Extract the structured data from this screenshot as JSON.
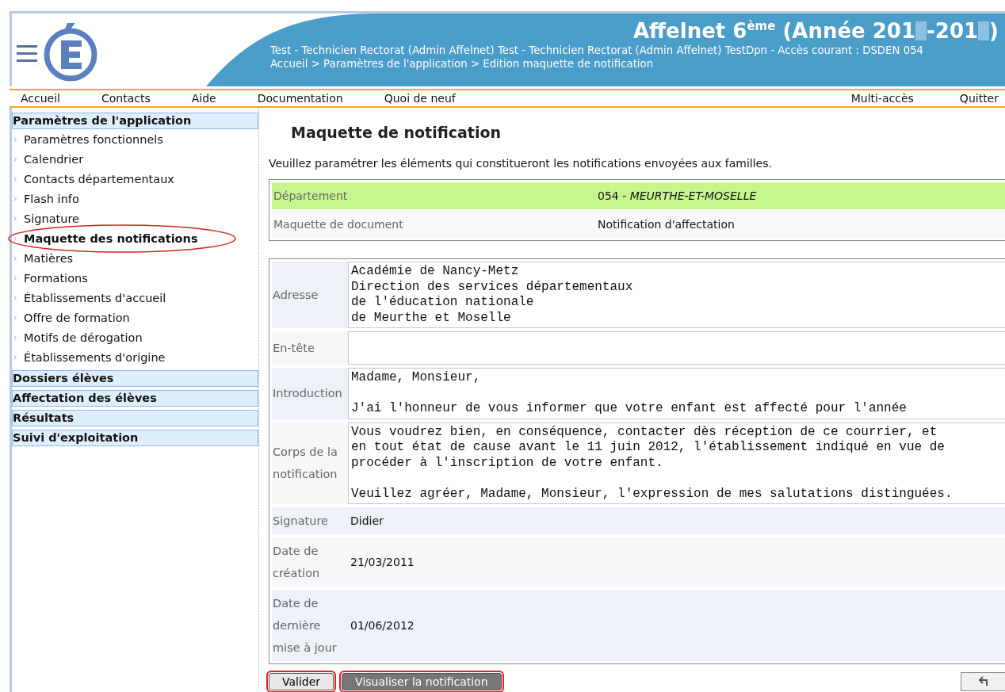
{
  "header": {
    "title_parts": [
      "Affelnet 6$^{ème}$ (Année 201",
      "-201",
      ")"
    ],
    "user_line": "Test - Technicien Rectorat (Admin Affelnet) Test - Technicien Rectorat (Admin Affelnet) TestDpn - Accès courant : DSDEN 054",
    "breadcrumb": "Accueil > Paramètres de l'application > Edition maquette de notification"
  },
  "nav": {
    "left": [
      "Accueil",
      "Contacts",
      "Aide",
      "Documentation",
      "Quoi de neuf"
    ],
    "right": [
      "Multi-accès",
      "Quitter"
    ]
  },
  "sidebar": [
    {
      "label": "Paramètres de l'application",
      "children": [
        {
          "label": "Paramètres fonctionnels",
          "selected": false,
          "circled": false
        },
        {
          "label": "Calendrier",
          "selected": false,
          "circled": false
        },
        {
          "label": "Contacts départementaux",
          "selected": false,
          "circled": false
        },
        {
          "label": "Flash info",
          "selected": false,
          "circled": false
        },
        {
          "label": "Signature",
          "selected": false,
          "circled": false
        },
        {
          "label": "Maquette des notifications",
          "selected": true,
          "circled": true
        },
        {
          "label": "Matières",
          "selected": false,
          "circled": false
        },
        {
          "label": "Formations",
          "selected": false,
          "circled": false
        },
        {
          "label": "Établissements d'accueil",
          "selected": false,
          "circled": false
        },
        {
          "label": "Offre de formation",
          "selected": false,
          "circled": false
        },
        {
          "label": "Motifs de dérogation",
          "selected": false,
          "circled": false
        },
        {
          "label": "Établissements d'origine",
          "selected": false,
          "circled": false
        }
      ]
    },
    {
      "label": "Dossiers élèves"
    },
    {
      "label": "Affectation des élèves"
    },
    {
      "label": "Résultats"
    },
    {
      "label": "Suivi d'exploitation"
    }
  ],
  "page_title": "Maquette de notification",
  "intro": "Veuillez paramétrer les éléments qui constitueront les notifications envoyées aux familles.",
  "summary": [
    {
      "label": "Département",
      "value": "054 - *MEURTHE-ET-MOSELLE*",
      "highlighted": true
    },
    {
      "label": "Maquette de document",
      "value": "Notification d'affectation",
      "highlighted": false
    }
  ],
  "fields": [
    {
      "label": "Adresse",
      "kind": "textarea",
      "value": "Académie de Nancy-Metz\nDirection des services départementaux\nde l'éducation nationale\nde Meurthe et Moselle"
    },
    {
      "label": "En-tête",
      "kind": "textarea"
    },
    {
      "label": "Introduction",
      "kind": "textarea",
      "value": "Madame, Monsieur,\n\nJ'ai l'honneur de vous informer que votre enfant est affecté pour l'année"
    },
    {
      "label": "Corps de la notification",
      "kind": "textarea",
      "value": "Vous voudrez bien, en conséquence, contacter dès réception de ce courrier, et\nen tout état de cause avant le 11 juin 2012, l'établissement indiqué en vue de\nprocéder à l'inscription de votre enfant.\n\nVeuillez agréer, Madame, Monsieur, l'expression de mes salutations distinguées."
    },
    {
      "label": "Signature",
      "kind": "text",
      "value": "Didier"
    },
    {
      "label": "Date de création",
      "kind": "text",
      "value": "21/03/2011"
    },
    {
      "label": "Date de dernière mise à jour",
      "kind": "text",
      "value": "01/06/2012"
    }
  ],
  "buttons": [
    {
      "label": "Valider",
      "kind": "light",
      "circled": true
    },
    {
      "label": "Visualiser la notification",
      "kind": "dark",
      "circled": true
    }
  ]
}
